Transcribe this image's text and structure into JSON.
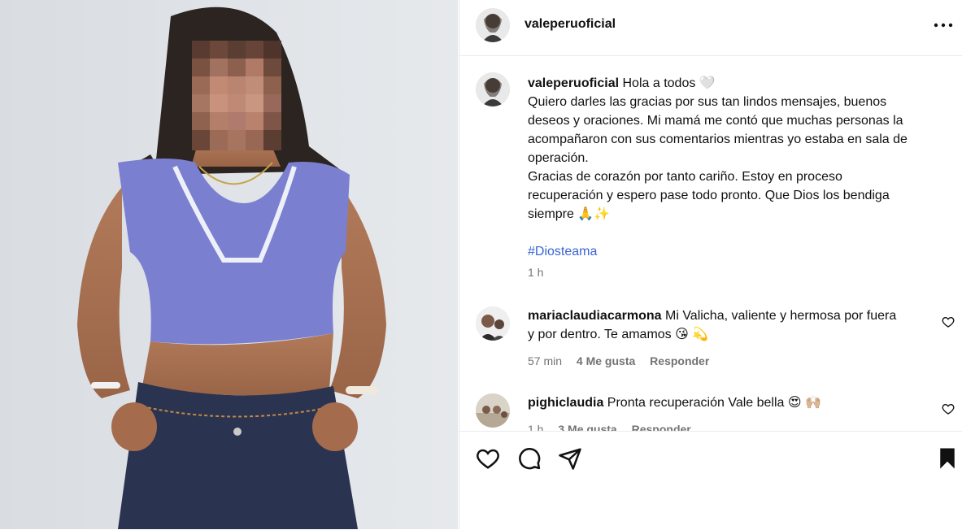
{
  "post": {
    "username": "valeperuoficial"
  },
  "caption": {
    "username": "valeperuoficial",
    "line1": "Hola a todos 🤍",
    "line2": "Quiero darles las gracias por sus tan lindos mensajes, buenos",
    "line3": "deseos y oraciones. Mi mamá me contó que muchas personas la",
    "line4": "acompañaron con sus comentarios mientras yo estaba en sala de",
    "line5": "operación.",
    "line6": "Gracias de corazón por tanto cariño. Estoy en proceso",
    "line7": "recuperación y espero pase todo pronto. Que Dios los bendiga",
    "line8": "siempre 🙏✨",
    "hashtag": "#Diosteama",
    "time": "1 h"
  },
  "comments": [
    {
      "username": "mariaclaudiacarmona",
      "text_line1": "Mi Valicha, valiente y hermosa por fuera",
      "text_line2": "y por dentro. Te amamos 😘 💫",
      "time": "57 min",
      "likes": "4 Me gusta",
      "reply": "Responder"
    },
    {
      "username": "pighiclaudia",
      "text_line1": "Pronta recuperación Vale bella 😍 🙌🏼",
      "time": "1 h",
      "likes": "3 Me gusta",
      "reply": "Responder"
    }
  ],
  "colors": {
    "hashtag": "#3a63d6",
    "muted": "#737373",
    "top_purple": "#7b7fd0",
    "jeans": "#2a334f"
  },
  "icons": [
    "more-icon",
    "heart-icon",
    "comment-icon",
    "share-icon",
    "bookmark-icon"
  ]
}
